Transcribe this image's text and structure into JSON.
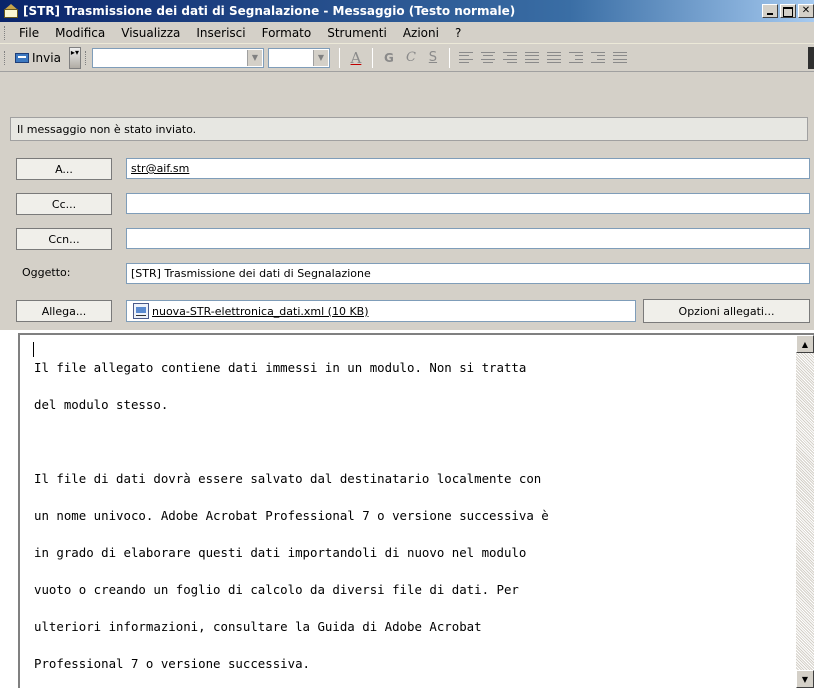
{
  "window": {
    "title": "[STR] Trasmissione dei dati di Segnalazione  - Messaggio (Testo normale)",
    "app_icon": "envelope-icon"
  },
  "menu": {
    "items": [
      {
        "label": "File"
      },
      {
        "label": "Modifica"
      },
      {
        "label": "Visualizza"
      },
      {
        "label": "Inserisci"
      },
      {
        "label": "Formato"
      },
      {
        "label": "Strumenti"
      },
      {
        "label": "Azioni"
      },
      {
        "label": "?"
      }
    ]
  },
  "toolbar": {
    "send_label": "Invia",
    "font_name": "",
    "font_size": "",
    "format_glyphs": {
      "font_color": "A",
      "bold": "G",
      "italic": "C",
      "underline": "S"
    }
  },
  "notice": "Il messaggio non è stato inviato.",
  "fields": {
    "to_button": "A...",
    "to_value": "str@aif.sm",
    "cc_button": "Cc...",
    "cc_value": "",
    "bcc_button": "Ccn...",
    "bcc_value": "",
    "subject_label": "Oggetto:",
    "subject_value": "[STR] Trasmissione dei dati di Segnalazione",
    "attach_button": "Allega...",
    "attachment_name": "nuova-STR-elettronica_dati.xml (10 KB)",
    "attachment_options_button": "Opzioni allegati..."
  },
  "body": {
    "lines": [
      "Il file allegato contiene dati immessi in un modulo. Non si tratta",
      "del modulo stesso.",
      "",
      "Il file di dati dovrà essere salvato dal destinatario localmente con",
      "un nome univoco. Adobe Acrobat Professional 7 o versione successiva è",
      "in grado di elaborare questi dati importandoli di nuovo nel modulo",
      "vuoto o creando un foglio di calcolo da diversi file di dati. Per",
      "ulteriori informazioni, consultare la Guida di Adobe Acrobat",
      "Professional 7 o versione successiva."
    ]
  }
}
